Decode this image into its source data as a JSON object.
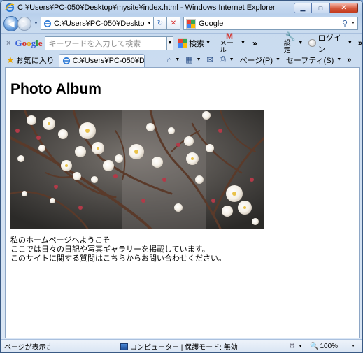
{
  "window": {
    "title": "C:¥Users¥PC-050¥Desktop¥mysite¥index.html - Windows Internet Explorer",
    "minimize_glyph": "▁",
    "maximize_glyph": "□",
    "close_glyph": "✕"
  },
  "addressbar": {
    "url": "C:¥Users¥PC-050¥Desktop¥mysite¥i",
    "refresh_glyph": "⁴⁄",
    "stop_glyph": "✕",
    "search_label": "Google",
    "search_glyph": "⌕"
  },
  "google_toolbar": {
    "close_glyph": "×",
    "logo": {
      "G": "G",
      "o1": "o",
      "o2": "o",
      "g": "g",
      "l": "l",
      "e": "e"
    },
    "search_placeholder": "キーワードを入力して検索",
    "search_button": "検索",
    "mail_glyph": "M",
    "mail_label": "メール",
    "more_glyph": "»",
    "settings_label": "設定",
    "login_label": "ログイン",
    "end_glyph": "»"
  },
  "favorites_bar": {
    "favorites_label": "お気に入り",
    "tab_label": "C:¥Users¥PC-050¥De...",
    "page_menu": "ページ(P)",
    "safety_menu": "セーフティ(S)",
    "overflow_glyph": "»"
  },
  "page": {
    "heading": "Photo Album",
    "lines": [
      "私のホームページへようこそ",
      "ここでは日々の日記や写真ギャラリーを掲載しています。",
      "このサイトに関する質問はこちらからお問い合わせください。"
    ]
  },
  "statusbar": {
    "status_text": "ページが表示さ",
    "zone_text": "コンピューター | 保護モード: 無効",
    "zoom": "100%"
  }
}
